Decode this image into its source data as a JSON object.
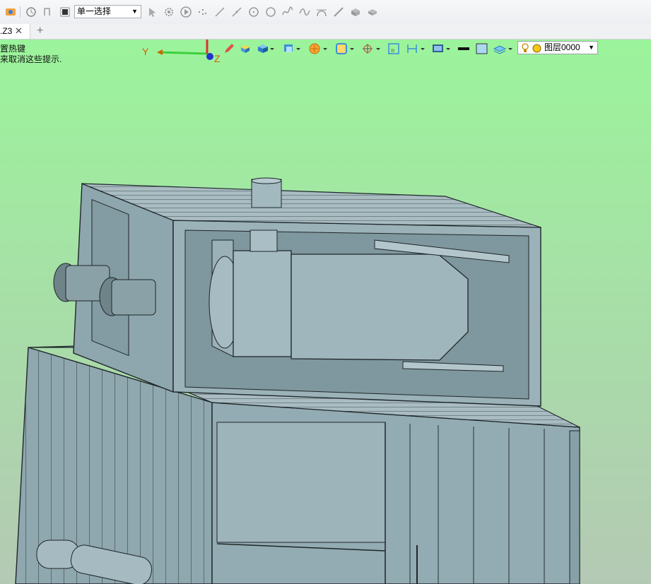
{
  "toolbar": {
    "select_value": "单一选择",
    "icons": [
      "app-menu-icon",
      "reset-view-icon",
      "undo-icon",
      "stop-icon",
      "cursor-icon",
      "gear-icon",
      "play-icon",
      "point-icon",
      "line-icon",
      "line2-icon",
      "circle-icon",
      "circle2-icon",
      "spline-icon",
      "sine-icon",
      "arc-icon",
      "slash-icon",
      "cube-icon",
      "cube2-icon"
    ]
  },
  "tabs": {
    "active_label": ".Z3",
    "close_glyph": "✕",
    "add_glyph": "+"
  },
  "viewport": {
    "hint_line1": "置热键",
    "hint_line2": "来取消这些提示.",
    "axis_y": "Y",
    "axis_z": "Z",
    "layer_select": "图层0000",
    "bg_top": "#9bf49b",
    "bg_bottom": "#b4c9b4",
    "model_color": "#8fa7ae"
  }
}
